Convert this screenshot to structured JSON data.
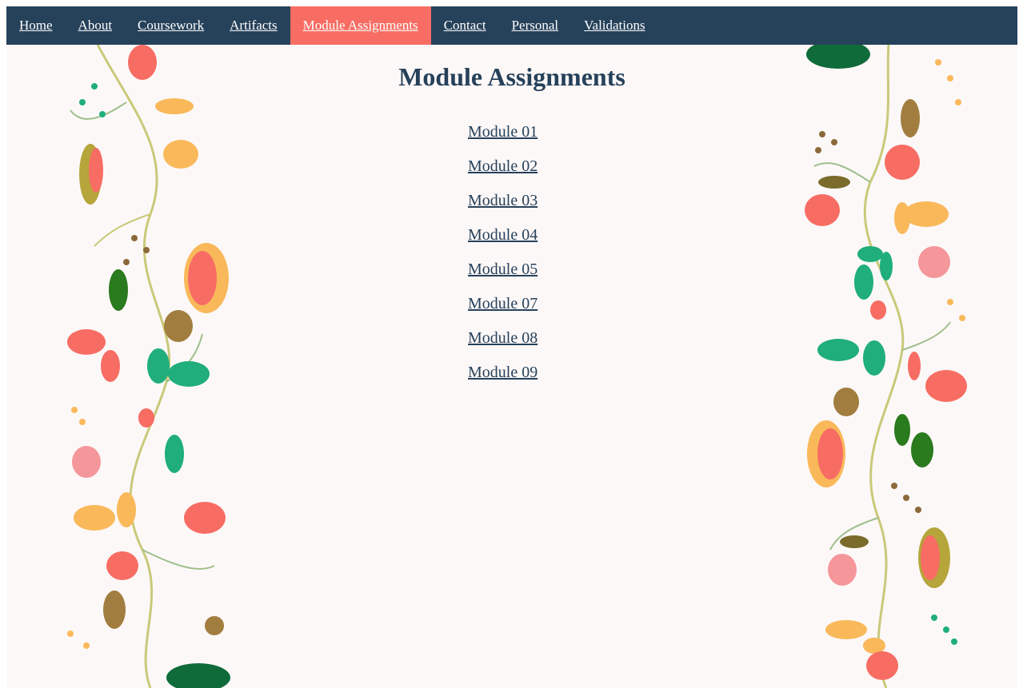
{
  "nav": {
    "items": [
      {
        "label": "Home"
      },
      {
        "label": "About"
      },
      {
        "label": "Coursework"
      },
      {
        "label": "Artifacts"
      },
      {
        "label": "Module Assignments",
        "active": true
      },
      {
        "label": "Contact"
      },
      {
        "label": "Personal"
      },
      {
        "label": "Validations"
      }
    ]
  },
  "main": {
    "title": "Module Assignments",
    "modules": [
      {
        "label": "Module 01"
      },
      {
        "label": "Module 02"
      },
      {
        "label": "Module 03"
      },
      {
        "label": "Module 04"
      },
      {
        "label": "Module 05"
      },
      {
        "label": "Module 07"
      },
      {
        "label": "Module 08"
      },
      {
        "label": "Module 09"
      }
    ]
  },
  "colors": {
    "nav_bg": "#26415a",
    "nav_active": "#f76d63",
    "heading": "#26415a",
    "page_bg": "#fdf8f8"
  },
  "decoration": {
    "icon": "floral-vine-border"
  }
}
